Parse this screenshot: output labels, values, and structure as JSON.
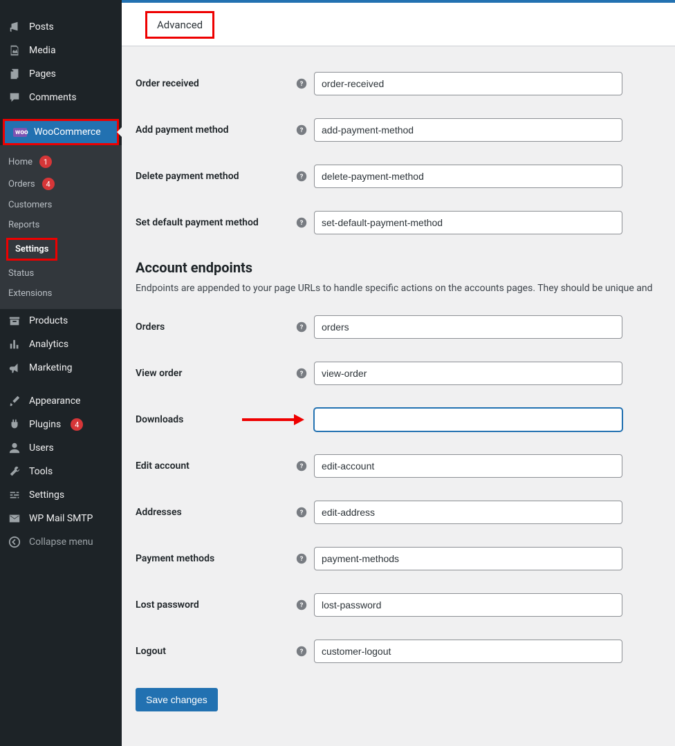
{
  "sidebar": {
    "posts": "Posts",
    "media": "Media",
    "pages": "Pages",
    "comments": "Comments",
    "woocommerce": "WooCommerce",
    "wc_sub": {
      "home": "Home",
      "home_badge": "1",
      "orders": "Orders",
      "orders_badge": "4",
      "customers": "Customers",
      "reports": "Reports",
      "settings": "Settings",
      "status": "Status",
      "extensions": "Extensions"
    },
    "products": "Products",
    "analytics": "Analytics",
    "marketing": "Marketing",
    "appearance": "Appearance",
    "plugins": "Plugins",
    "plugins_badge": "4",
    "users": "Users",
    "tools": "Tools",
    "settings": "Settings",
    "wpmailsmtp": "WP Mail SMTP",
    "collapse": "Collapse menu"
  },
  "tab": {
    "advanced": "Advanced"
  },
  "fields": {
    "order_received": {
      "label": "Order received",
      "value": "order-received"
    },
    "add_payment": {
      "label": "Add payment method",
      "value": "add-payment-method"
    },
    "delete_payment": {
      "label": "Delete payment method",
      "value": "delete-payment-method"
    },
    "set_default_payment": {
      "label": "Set default payment method",
      "value": "set-default-payment-method"
    }
  },
  "section": {
    "title": "Account endpoints",
    "desc": "Endpoints are appended to your page URLs to handle specific actions on the accounts pages. They should be unique and "
  },
  "fields2": {
    "orders": {
      "label": "Orders",
      "value": "orders"
    },
    "view_order": {
      "label": "View order",
      "value": "view-order"
    },
    "downloads": {
      "label": "Downloads",
      "value": ""
    },
    "edit_account": {
      "label": "Edit account",
      "value": "edit-account"
    },
    "addresses": {
      "label": "Addresses",
      "value": "edit-address"
    },
    "payment_methods": {
      "label": "Payment methods",
      "value": "payment-methods"
    },
    "lost_password": {
      "label": "Lost password",
      "value": "lost-password"
    },
    "logout": {
      "label": "Logout",
      "value": "customer-logout"
    }
  },
  "save": "Save changes"
}
